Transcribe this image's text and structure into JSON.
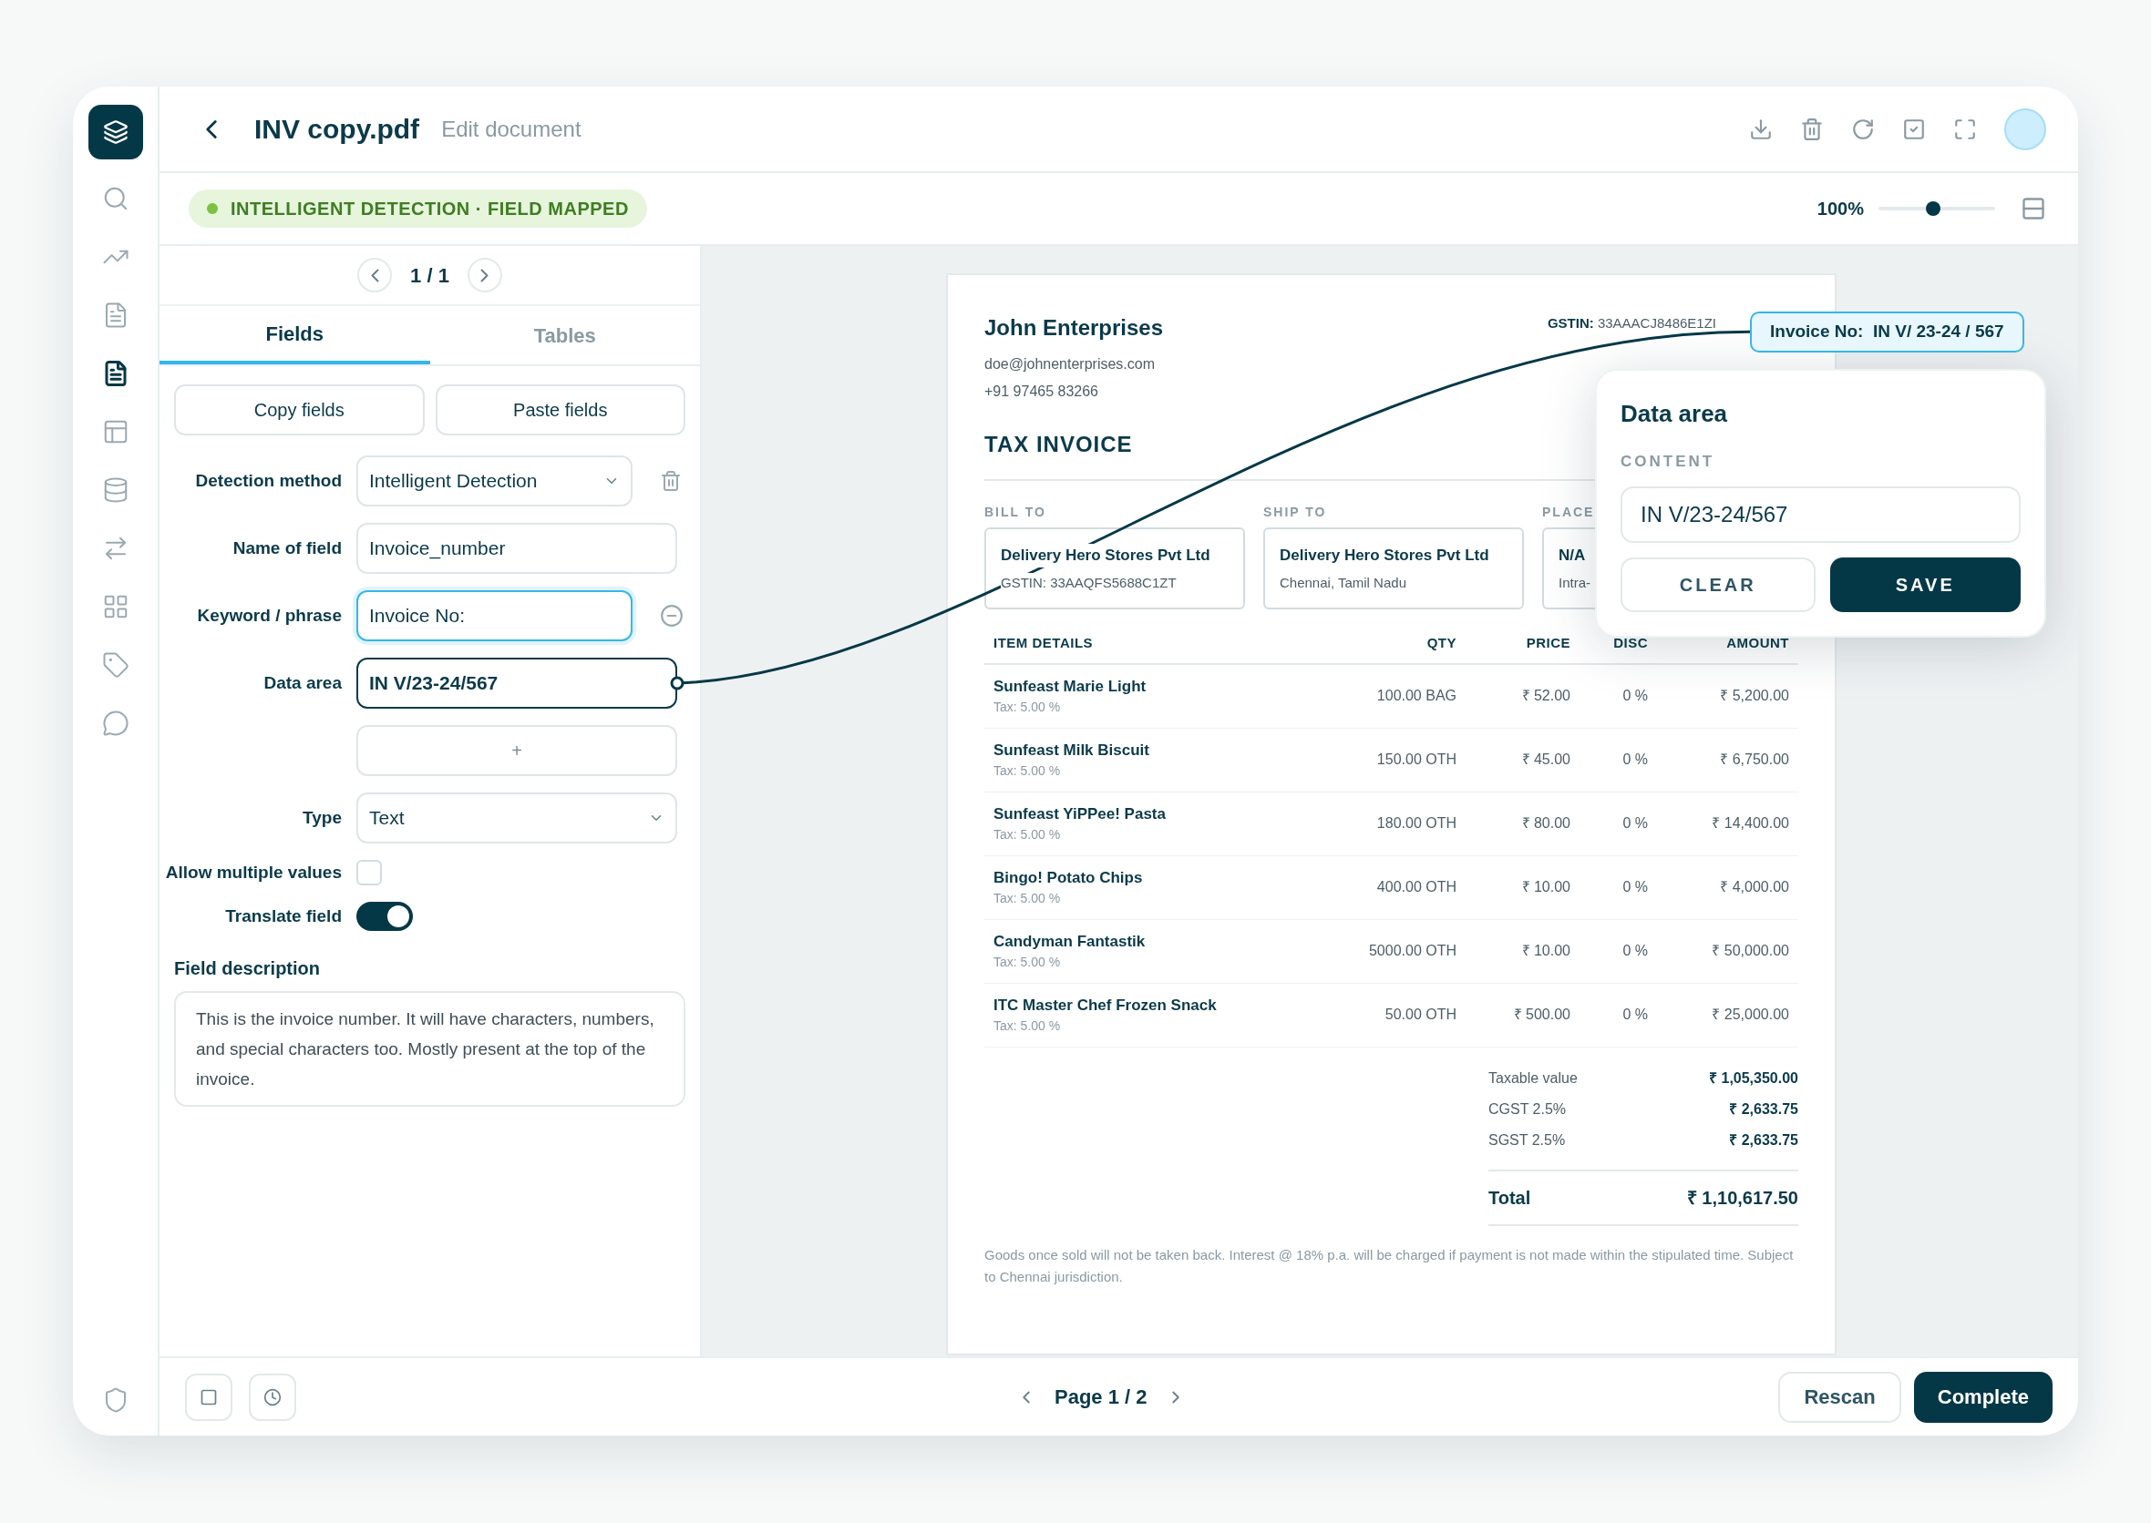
{
  "sidebar": {
    "items": [
      {
        "selected": false
      },
      {
        "selected": false
      },
      {
        "selected": false
      },
      {
        "selected": true
      },
      {
        "selected": false
      },
      {
        "selected": false
      },
      {
        "selected": false
      },
      {
        "selected": false
      },
      {
        "selected": false
      },
      {
        "selected": false
      }
    ]
  },
  "header": {
    "title": "INV copy.pdf",
    "subtitle": "Edit document"
  },
  "status": {
    "label": "INTELLIGENT DETECTION · FIELD MAPPED",
    "zoom": {
      "reading": "100%",
      "level": 0.47
    }
  },
  "panel": {
    "pager": "1 / 1",
    "tabs": [
      {
        "label": "Fields",
        "selected": true
      },
      {
        "label": "Tables",
        "selected": false
      }
    ],
    "actions": [
      "Copy fields",
      "Paste fields"
    ],
    "form": [
      {
        "kind": "select",
        "label": "Detection method",
        "value": "Intelligent Detection"
      },
      {
        "kind": "input",
        "label": "Name of field",
        "value": "Invoice_number",
        "focused": false,
        "linked": false
      },
      {
        "kind": "input",
        "label": "Keyword / phrase",
        "value": "Invoice No:",
        "focused": true,
        "linked": false
      },
      {
        "kind": "input",
        "label": "Data area",
        "value": "IN V/23-24/567",
        "focused": false,
        "linked": true
      },
      {
        "kind": "add",
        "value": "+"
      },
      {
        "kind": "select",
        "label": "Type",
        "value": "Text"
      },
      {
        "kind": "checkbox",
        "label": "Allow multiple values",
        "checked": false
      },
      {
        "kind": "toggle",
        "label": "Translate field",
        "on": true
      }
    ],
    "description": {
      "label": "Field description",
      "value": "This is the invoice number. It will have characters, numbers, and special characters too. Mostly present at the top of the invoice."
    }
  },
  "document": {
    "company": "John Enterprises",
    "email": "doe@johnenterprises.com",
    "phone": "+91 97465 83266",
    "gstin_label": "GSTIN:",
    "gstin": "33AAACJ8486E1ZI",
    "title": "TAX INVOICE",
    "parties": [
      {
        "label": "BILL TO",
        "name": "Delivery Hero Stores Pvt Ltd",
        "detail": "GSTIN: 33AAQFS5688C1ZT"
      },
      {
        "label": "SHIP TO",
        "name": "Delivery Hero Stores Pvt Ltd",
        "detail": "Chennai, Tamil Nadu"
      },
      {
        "label": "PLACE",
        "name": "N/A",
        "detail": "Intra-"
      }
    ],
    "columns": [
      "ITEM DETAILS",
      "QTY",
      "PRICE",
      "DISC",
      "AMOUNT"
    ],
    "rows": [
      {
        "name": "Sunfeast Marie Light",
        "tax": "Tax: 5.00 %",
        "qty": "100.00 BAG",
        "price": "₹ 52.00",
        "disc": "0 %",
        "amount": "₹ 5,200.00"
      },
      {
        "name": "Sunfeast Milk Biscuit",
        "tax": "Tax: 5.00 %",
        "qty": "150.00 OTH",
        "price": "₹ 45.00",
        "disc": "0 %",
        "amount": "₹ 6,750.00"
      },
      {
        "name": "Sunfeast YiPPee! Pasta",
        "tax": "Tax: 5.00 %",
        "qty": "180.00 OTH",
        "price": "₹ 80.00",
        "disc": "0 %",
        "amount": "₹ 14,400.00"
      },
      {
        "name": "Bingo! Potato Chips",
        "tax": "Tax: 5.00 %",
        "qty": "400.00 OTH",
        "price": "₹ 10.00",
        "disc": "0 %",
        "amount": "₹ 4,000.00"
      },
      {
        "name": "Candyman Fantastik",
        "tax": "Tax: 5.00 %",
        "qty": "5000.00 OTH",
        "price": "₹ 10.00",
        "disc": "0 %",
        "amount": "₹ 50,000.00"
      },
      {
        "name": "ITC Master Chef Frozen Snack",
        "tax": "Tax: 5.00 %",
        "qty": "50.00 OTH",
        "price": "₹ 500.00",
        "disc": "0 %",
        "amount": "₹ 25,000.00"
      }
    ],
    "totals": [
      {
        "label": "Taxable value",
        "value": "₹ 1,05,350.00"
      },
      {
        "label": "CGST 2.5%",
        "value": "₹ 2,633.75"
      },
      {
        "label": "SGST 2.5%",
        "value": "₹ 2,633.75"
      }
    ],
    "total": {
      "label": "Total",
      "value": "₹ 1,10,617.50"
    },
    "note": "Goods once sold will not be taken back. Interest @ 18% p.a. will be charged if payment is not made within the stipulated time. Subject to Chennai jurisdiction."
  },
  "chip": "Invoice No:  IN V/ 23-24 / 567",
  "popup": {
    "title": "Data area",
    "label": "CONTENT",
    "value": "IN V/23-24/567",
    "buttons": [
      "CLEAR",
      "SAVE"
    ]
  },
  "footer": {
    "pager": "Page 1 / 2",
    "buttons": [
      "Rescan",
      "Complete"
    ]
  }
}
